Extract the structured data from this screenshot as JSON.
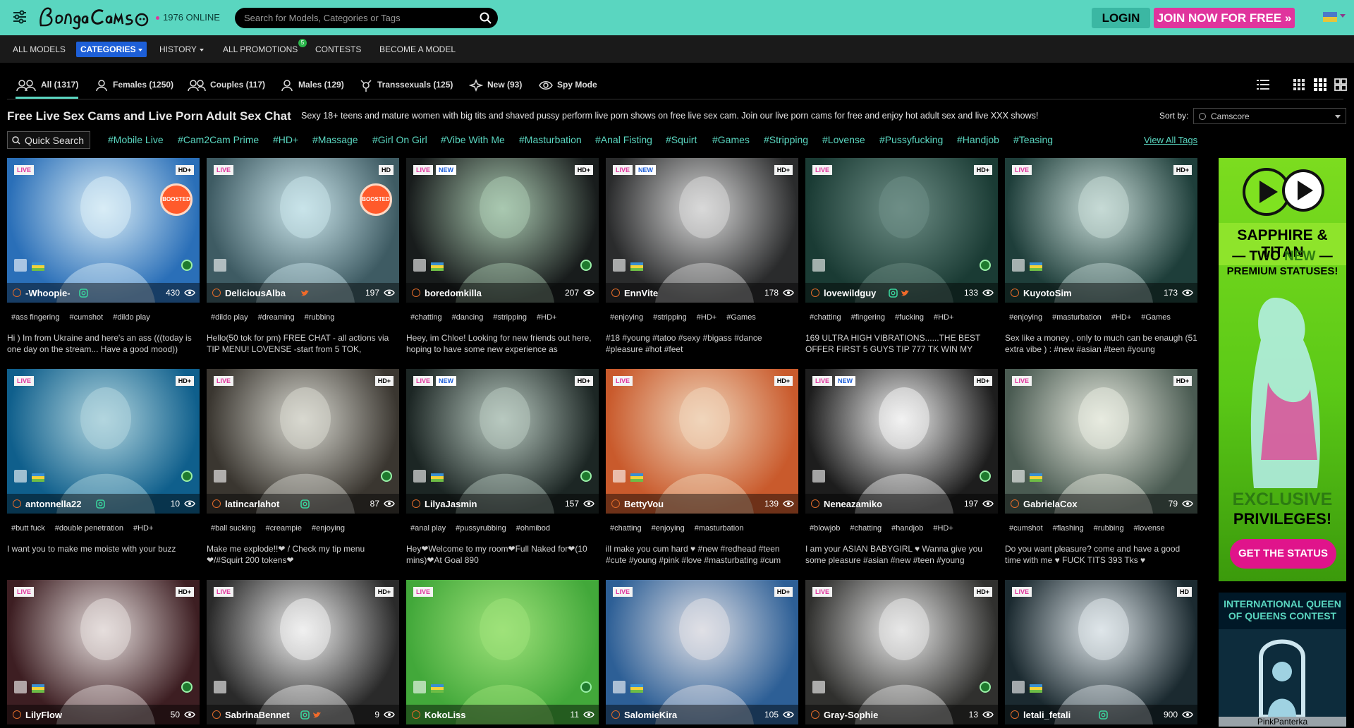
{
  "header": {
    "online_count": "1976 ONLINE",
    "search_placeholder": "Search for Models, Categories or Tags",
    "login_label": "LOGIN",
    "join_label": "JOIN NOW FOR FREE »",
    "accent_color": "#5ad6c0",
    "brand_pink": "#e0349d"
  },
  "nav": {
    "items": [
      {
        "label": "ALL MODELS",
        "dropdown": false
      },
      {
        "label": "CATEGORIES",
        "dropdown": true,
        "active": true
      },
      {
        "label": "HISTORY",
        "dropdown": true
      },
      {
        "label": "ALL PROMOTIONS",
        "dropdown": false
      },
      {
        "label": "CONTESTS",
        "dropdown": false
      },
      {
        "label": "BECOME A MODEL",
        "dropdown": false
      }
    ],
    "promotions_badge": "5"
  },
  "tabs": [
    {
      "label": "All (1317)",
      "icon": "group-icon",
      "active": true
    },
    {
      "label": "Females (1250)",
      "icon": "female-icon"
    },
    {
      "label": "Couples (117)",
      "icon": "couple-icon"
    },
    {
      "label": "Males (129)",
      "icon": "male-icon"
    },
    {
      "label": "Transsexuals (125)",
      "icon": "trans-icon"
    },
    {
      "label": "New (93)",
      "icon": "sparkle-icon"
    },
    {
      "label": "Spy Mode",
      "icon": "eye-icon"
    }
  ],
  "heading": {
    "title": "Free Live Sex Cams and Live Porn Adult Sex Chat",
    "description": "Sexy 18+ teens and mature women with big tits and shaved pussy perform live porn shows on free live sex cam. Join our live porn cams for free and enjoy hot adult sex and live XXX shows!",
    "sort_label": "Sort by:",
    "sort_value": "Camscore"
  },
  "tagbar": {
    "quick_search": "Quick Search",
    "tags": [
      "#Mobile Live",
      "#Cam2Cam Prime",
      "#HD+",
      "#Massage",
      "#Girl On Girl",
      "#Vibe With Me",
      "#Masturbation",
      "#Anal Fisting",
      "#Squirt",
      "#Games",
      "#Stripping",
      "#Lovense",
      "#Pussyfucking",
      "#Handjob",
      "#Teasing"
    ],
    "view_all": "View All Tags"
  },
  "models": [
    {
      "name": "-Whoopie-",
      "viewers": "430",
      "quality": "HD+",
      "new": false,
      "boosted": true,
      "tags": [
        "#ass fingering",
        "#cumshot",
        "#dildo play"
      ],
      "desc": "Hi ) Im from Ukraine and here's an ass (((today is one day on the stream... Have a good mood))",
      "tint": [
        "#2a6fb8",
        "#d8ecf6"
      ]
    },
    {
      "name": "DeliciousAlba",
      "viewers": "197",
      "quality": "HD",
      "new": false,
      "boosted": true,
      "tags": [
        "#dildo play",
        "#dreaming",
        "#rubbing"
      ],
      "desc": "Hello(50 tok for pm) FREE CHAT - all actions via TIP MENU! LOVENSE -start from 5 TOK,",
      "tint": [
        "#3e5b63",
        "#c9e4ea"
      ]
    },
    {
      "name": "boredomkilla",
      "viewers": "207",
      "quality": "HD+",
      "new": true,
      "boosted": false,
      "tags": [
        "#chatting",
        "#dancing",
        "#stripping",
        "#HD+"
      ],
      "desc": "Heey, im Chloe! Looking for new friends out here, hoping to have some new experience as",
      "tint": [
        "#181c1c",
        "#a9c8b0"
      ]
    },
    {
      "name": "EnnVite",
      "viewers": "178",
      "quality": "HD+",
      "new": true,
      "boosted": false,
      "tags": [
        "#enjoying",
        "#stripping",
        "#HD+",
        "#Games"
      ],
      "desc": "#18 #young #tatoo #sexy #bigass #dance #pleasure #hot #feet",
      "tint": [
        "#2a2b2c",
        "#d9d9d9"
      ]
    },
    {
      "name": "lovewildguy",
      "viewers": "133",
      "quality": "HD+",
      "new": false,
      "boosted": false,
      "tags": [
        "#chatting",
        "#fingering",
        "#fucking",
        "#HD+"
      ],
      "desc": "169 ULTRA HIGH VIBRATIONS......THE BEST OFFER FIRST 5 GUYS TIP 777 TK WIN MY",
      "tint": [
        "#1a3b34",
        "#6e8e86"
      ]
    },
    {
      "name": "KuyotoSim",
      "viewers": "173",
      "quality": "HD+",
      "new": false,
      "boosted": false,
      "tags": [
        "#enjoying",
        "#masturbation",
        "#HD+",
        "#Games"
      ],
      "desc": "Sex like a money , only to much can be enaugh (51 extra vibe ) : #new #asian #teen #young",
      "tint": [
        "#1e3e3a",
        "#c6dad6"
      ]
    },
    {
      "name": "antonnella22",
      "viewers": "10",
      "quality": "HD+",
      "new": false,
      "boosted": false,
      "tags": [
        "#butt fuck",
        "#double penetration",
        "#HD+"
      ],
      "desc": "I want you to make me moiste with your buzz",
      "tint": [
        "#0f5f8c",
        "#b2d6df"
      ]
    },
    {
      "name": "latincarlahot",
      "viewers": "87",
      "quality": "HD+",
      "new": false,
      "boosted": false,
      "tags": [
        "#ball sucking",
        "#creampie",
        "#enjoying"
      ],
      "desc": "Make me explode!!❤ / Check my tip menu ❤/#Squirt 200 tokens❤",
      "tint": [
        "#3a3630",
        "#d8d8d0"
      ]
    },
    {
      "name": "LilyaJasmin",
      "viewers": "157",
      "quality": "HD+",
      "new": true,
      "boosted": false,
      "tags": [
        "#anal play",
        "#pussyrubbing",
        "#ohmibod"
      ],
      "desc": "Hey❤Welcome to my room❤Full Naked for❤(10 mins)❤At Goal 890",
      "tint": [
        "#1c2624",
        "#b8c9c0"
      ]
    },
    {
      "name": "BettyVou",
      "viewers": "139",
      "quality": "HD+",
      "new": false,
      "boosted": false,
      "tags": [
        "#chatting",
        "#enjoying",
        "#masturbation"
      ],
      "desc": "ill make you cum hard ♥ #new #redhead #teen #cute #young #pink #love #masturbating #cum",
      "tint": [
        "#c95a2c",
        "#f0d6bb"
      ]
    },
    {
      "name": "Neneazamiko",
      "viewers": "197",
      "quality": "HD+",
      "new": true,
      "boosted": false,
      "tags": [
        "#blowjob",
        "#chatting",
        "#handjob",
        "#HD+"
      ],
      "desc": "I am your ASIAN BABYGIRL ♥ Wanna give you some pleasure #asian #new #teen #young",
      "tint": [
        "#1d1d1d",
        "#f2f2f2"
      ]
    },
    {
      "name": "GabrielaCox",
      "viewers": "79",
      "quality": "HD+",
      "new": false,
      "boosted": false,
      "tags": [
        "#cumshot",
        "#flashing",
        "#rubbing",
        "#lovense"
      ],
      "desc": "Do you want pleasure? come and have a good time with me ♥ FUCK TITS 393 Tks ♥",
      "tint": [
        "#4a5b52",
        "#e8ebe0"
      ]
    },
    {
      "name": "LilyFlow",
      "viewers": "50",
      "quality": "HD+",
      "new": false,
      "boosted": false,
      "tags": [],
      "desc": "",
      "tint": [
        "#3d1e22",
        "#e6dedd"
      ]
    },
    {
      "name": "SabrinaBennet",
      "viewers": "9",
      "quality": "HD+",
      "new": false,
      "boosted": false,
      "tags": [],
      "desc": "",
      "tint": [
        "#2a2a2a",
        "#f0f0f0"
      ]
    },
    {
      "name": "KokoLiss",
      "viewers": "11",
      "quality": "",
      "new": false,
      "boosted": false,
      "tags": [],
      "desc": "",
      "tint": [
        "#42a83a",
        "#9fe27a"
      ]
    },
    {
      "name": "SalomieKira",
      "viewers": "105",
      "quality": "HD+",
      "new": false,
      "boosted": false,
      "tags": [],
      "desc": "",
      "tint": [
        "#2d5f96",
        "#e0e0e6"
      ]
    },
    {
      "name": "Gray-Sophie",
      "viewers": "13",
      "quality": "HD+",
      "new": false,
      "boosted": false,
      "tags": [],
      "desc": "",
      "tint": [
        "#30302e",
        "#e8e8e8"
      ]
    },
    {
      "name": "letali_fetali",
      "viewers": "900",
      "quality": "HD",
      "new": false,
      "boosted": false,
      "tags": [],
      "desc": "",
      "tint": [
        "#1b2a30",
        "#dfe6ea"
      ]
    }
  ],
  "labels": {
    "live": "LIVE",
    "new": "NEW",
    "boosted": "BOOSTED"
  },
  "ads": {
    "ad1_title": "SAPPHIRE & TITAN",
    "ad1_two": "— TWO ",
    "ad1_new": "NEW",
    "ad1_dash": " —",
    "ad1_sub": "PREMIUM STATUSES!",
    "ad1_exclusive": "EXCLUSIVE",
    "ad1_priv": "PRIVILEGES!",
    "ad1_button": "GET THE STATUS",
    "ad2_title": "INTERNATIONAL QUEEN OF QUEENS CONTEST",
    "ad2_caption": "PinkPanterka"
  }
}
